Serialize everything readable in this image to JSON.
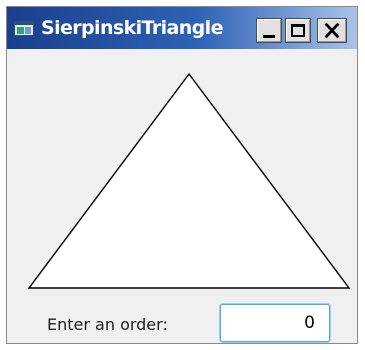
{
  "window": {
    "title": "SierpinskiTriangle",
    "icon": "app-window-icon",
    "controls": {
      "minimize_icon": "minimize-icon",
      "maximize_icon": "maximize-icon",
      "close_icon": "close-icon"
    }
  },
  "canvas": {
    "shape": "triangle",
    "stroke_color": "#000000",
    "fill_color": "#ffffff"
  },
  "form": {
    "label": "Enter an order:",
    "order_value": "0"
  }
}
